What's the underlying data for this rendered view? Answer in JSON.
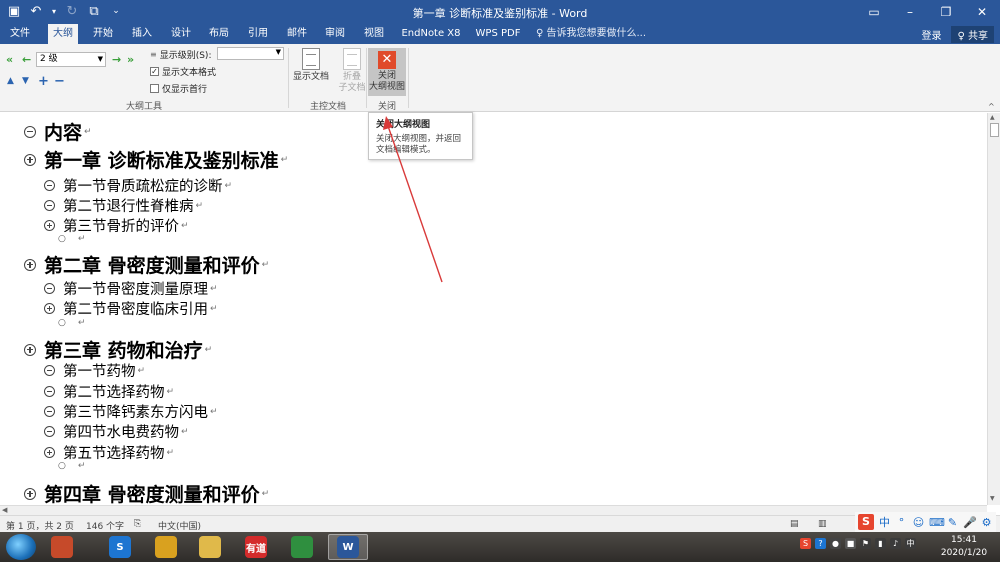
{
  "window": {
    "title": "第一章 诊断标准及鉴别标准 - Word",
    "controls": [
      "▭",
      "–",
      "❐",
      "✕"
    ]
  },
  "quick_access": {
    "save_icon": "save-icon",
    "undo_icon": "undo-icon",
    "redo_icon": "redo-icon",
    "touch_icon": "touch-mode-icon",
    "customize_icon": "customize-qat-icon"
  },
  "tabs": [
    "文件",
    "大纲",
    "开始",
    "插入",
    "设计",
    "布局",
    "引用",
    "邮件",
    "审阅",
    "视图",
    "EndNote X8",
    "WPS PDF"
  ],
  "active_tab": "大纲",
  "tell_me": "♀ 告诉我您想要做什么...",
  "account": {
    "signin": "登录",
    "share": "♀ 共享"
  },
  "ribbon": {
    "outline_tools": {
      "level_value": "2 级",
      "show_level_label": "显示级别(S):",
      "show_level_value": "",
      "show_text_format": "显示文本格式",
      "show_text_format_checked": true,
      "first_line_only": "仅显示首行",
      "first_line_only_checked": false,
      "group_label": "大纲工具"
    },
    "master_document": {
      "show_document": "显示文档",
      "collapse_l1": "折叠",
      "collapse_l2": "子文档",
      "group_label": "主控文档"
    },
    "close": {
      "close_l1": "关闭",
      "close_l2": "大纲视图",
      "group_label": "关闭"
    }
  },
  "tooltip": {
    "title": "关闭大纲视图",
    "line1": "关闭大纲视图，并返回",
    "line2": "文档编辑模式。"
  },
  "outline": [
    {
      "level": 1,
      "sym": "minus",
      "text": "内容"
    },
    {
      "level": 1,
      "sym": "plus",
      "text": "第一章  诊断标准及鉴别标准"
    },
    {
      "level": 2,
      "sym": "minus",
      "text": "第一节骨质疏松症的诊断"
    },
    {
      "level": 2,
      "sym": "minus",
      "text": "第二节退行性脊椎病"
    },
    {
      "level": 2,
      "sym": "plus",
      "text": "第三节骨折的评价"
    },
    {
      "level": 3,
      "sym": "dot",
      "text": ""
    },
    {
      "level": 1,
      "sym": "plus",
      "text": "第二章  骨密度测量和评价"
    },
    {
      "level": 2,
      "sym": "minus",
      "text": "第一节骨密度测量原理"
    },
    {
      "level": 2,
      "sym": "plus",
      "text": "第二节骨密度临床引用"
    },
    {
      "level": 3,
      "sym": "dot",
      "text": ""
    },
    {
      "level": 1,
      "sym": "plus",
      "text": "第三章  药物和治疗"
    },
    {
      "level": 2,
      "sym": "minus",
      "text": "第一节药物"
    },
    {
      "level": 2,
      "sym": "minus",
      "text": "第二节选择药物"
    },
    {
      "level": 2,
      "sym": "minus",
      "text": "第三节降钙素东方闪电"
    },
    {
      "level": 2,
      "sym": "minus",
      "text": "第四节水电费药物"
    },
    {
      "level": 2,
      "sym": "plus",
      "text": "第五节选择药物"
    },
    {
      "level": 3,
      "sym": "dot",
      "text": ""
    },
    {
      "level": 1,
      "sym": "plus",
      "text": "第四章  骨密度测量和评价"
    }
  ],
  "paragraph_mark": "↵",
  "status": {
    "page": "第 1 页，共 2 页",
    "words": "146 个字",
    "language": "中文(中国)"
  },
  "ime_icons": [
    "S",
    "中",
    "°",
    "☺",
    "⌨",
    "✎",
    "🎤",
    "⚙"
  ],
  "taskbar": {
    "apps": [
      {
        "name": "app-cluster-icon",
        "label": "",
        "color": "#c64a2a"
      },
      {
        "name": "sogou-browser-icon",
        "label": "S",
        "color": "#1d75d1"
      },
      {
        "name": "chrome-icon",
        "label": "",
        "color": "#d9a11f"
      },
      {
        "name": "file-explorer-icon",
        "label": "",
        "color": "#e0b94a"
      },
      {
        "name": "youdao-icon",
        "label": "有道",
        "color": "#d42b2b"
      },
      {
        "name": "photo-app-icon",
        "label": "",
        "color": "#2f8f3f"
      },
      {
        "name": "word-icon",
        "label": "W",
        "color": "#2b579a"
      }
    ],
    "time": "15:41",
    "date": "2020/1/20"
  }
}
